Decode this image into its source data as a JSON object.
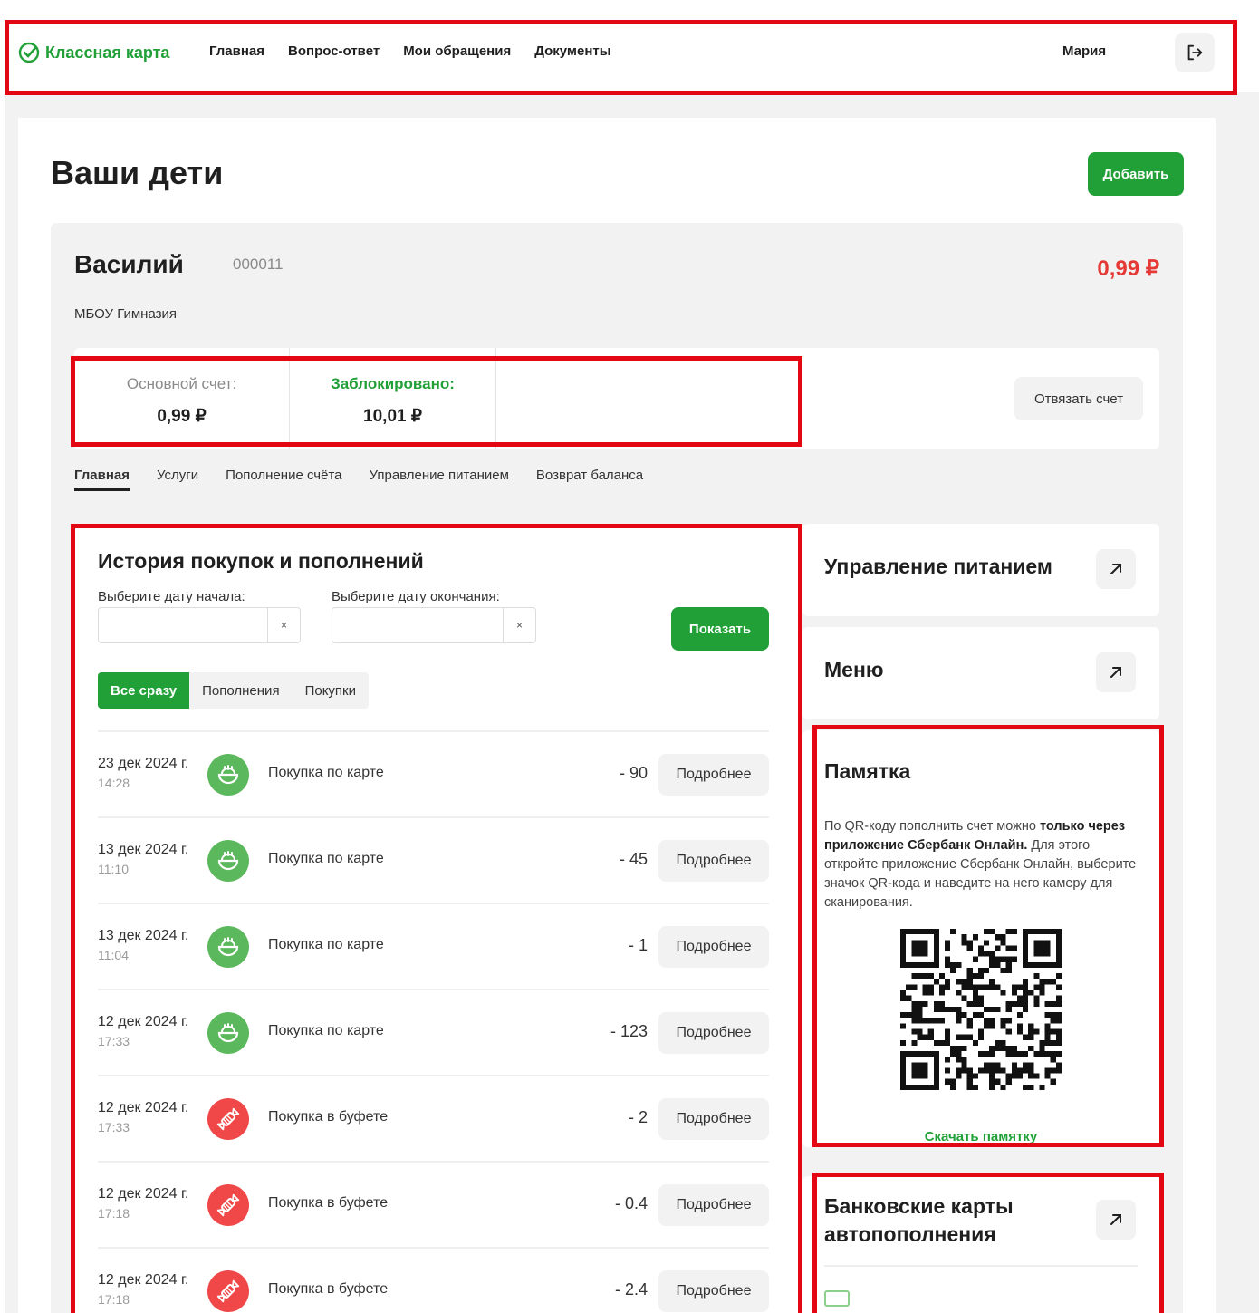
{
  "header": {
    "logo_text": "Классная карта",
    "nav": [
      "Главная",
      "Вопрос-ответ",
      "Мои обращения",
      "Документы"
    ],
    "user_name": "Мария",
    "logout_icon": "logout-icon"
  },
  "page": {
    "title": "Ваши дети",
    "add_button": "Добавить"
  },
  "child": {
    "name": "Василий",
    "id": "000011",
    "balance": "0,99 ₽",
    "school": "МБОУ Гимназия",
    "accounts": [
      {
        "label": "Основной счет:",
        "value": "0,99 ₽"
      },
      {
        "label": "Заблокировано:",
        "value": "10,01 ₽"
      }
    ],
    "unlink_button": "Отвязать счет",
    "tabs": [
      "Главная",
      "Услуги",
      "Пополнение счёта",
      "Управление питанием",
      "Возврат баланса"
    ],
    "active_tab": "Главная"
  },
  "history": {
    "title": "История покупок и пополнений",
    "start_label": "Выберите дату начала:",
    "end_label": "Выберите дату окончания:",
    "start_value": "",
    "end_value": "",
    "clear_symbol": "×",
    "show_button": "Показать",
    "filters": [
      "Все сразу",
      "Пополнения",
      "Покупки"
    ],
    "active_filter": "Все сразу",
    "more_label": "Подробнее",
    "transactions": [
      {
        "date": "23 дек 2024 г.",
        "time": "14:28",
        "icon": "food-bowl-icon",
        "description": "Покупка по карте",
        "amount": "- 90"
      },
      {
        "date": "13 дек 2024 г.",
        "time": "11:10",
        "icon": "food-bowl-icon",
        "description": "Покупка по карте",
        "amount": "- 45"
      },
      {
        "date": "13 дек 2024 г.",
        "time": "11:04",
        "icon": "food-bowl-icon",
        "description": "Покупка по карте",
        "amount": "- 1"
      },
      {
        "date": "12 дек 2024 г.",
        "time": "17:33",
        "icon": "food-bowl-icon",
        "description": "Покупка по карте",
        "amount": "- 123"
      },
      {
        "date": "12 дек 2024 г.",
        "time": "17:33",
        "icon": "candy-icon",
        "description": "Покупка в буфете",
        "amount": "- 2"
      },
      {
        "date": "12 дек 2024 г.",
        "time": "17:18",
        "icon": "candy-icon",
        "description": "Покупка в буфете",
        "amount": "- 0.4"
      },
      {
        "date": "12 дек 2024 г.",
        "time": "17:18",
        "icon": "candy-icon",
        "description": "Покупка в буфете",
        "amount": "- 2.4"
      }
    ]
  },
  "sidebar": {
    "nutrition_title": "Управление питанием",
    "menu_title": "Меню",
    "memo": {
      "title": "Памятка",
      "text_1": "По QR-коду пополнить счет можно ",
      "text_bold": "только через приложение Сбербанк Онлайн.",
      "text_2": " Для этого откройте приложение Сбербанк Онлайн, выберите значок QR-кода и наведите на него камеру для сканирования.",
      "download_link": "Скачать памятку"
    },
    "bank_cards_title_line1": "Банковские карты",
    "bank_cards_title_line2": "автопополнения"
  },
  "colors": {
    "accent": "#21a038",
    "balance": "#e53935",
    "annotation": "#e30613"
  }
}
